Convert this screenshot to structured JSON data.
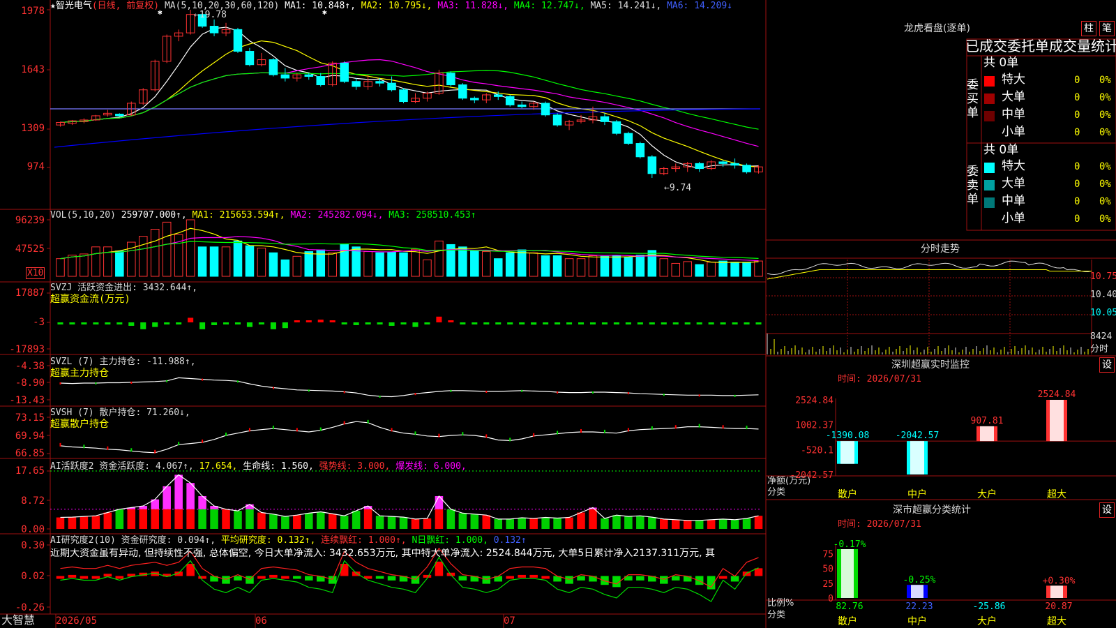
{
  "colors": {
    "up": "#ff3232",
    "down": "#00ffff",
    "ma1": "#ffffff",
    "ma2": "#ffff00",
    "ma3": "#ff00ff",
    "ma4": "#00ff00",
    "ma5": "#7878ff",
    "ma6": "#0000ff",
    "grid": "#a01010",
    "pos": "#ff0000",
    "neg": "#00dd00",
    "bg": "#000000"
  },
  "header": {
    "title": "★智光电气",
    "period": "(日线, 前复权)",
    "ma_params": "MA(5,10,20,30,60,120)",
    "ma1": "MA1: 10.848↑,",
    "ma2": "MA2: 10.795↓,",
    "ma3": "MA3: 11.828↓,",
    "ma4": "MA4: 12.747↓,",
    "ma5": "MA5: 14.241↓,",
    "ma6": "MA6: 14.209↓"
  },
  "price_panel": {
    "y_labels": [
      "1978",
      "1643",
      "1309",
      "974"
    ],
    "high_marker": "←19.78",
    "low_marker": "←9.74",
    "star": "✱"
  },
  "vol_panel": {
    "header_name": "VOL(5,10,20)",
    "header_val": "259707.000↑,",
    "ma1": "MA1: 215653.594↑,",
    "ma2": "MA2: 245282.094↓,",
    "ma3": "MA3: 258510.453↑",
    "y_labels": [
      "96239",
      "47525"
    ],
    "unit": "X10"
  },
  "svzj_panel": {
    "header": "SVZJ  活跃资金进出: 3432.644↑,",
    "sub": "超赢资金流(万元)",
    "y_labels": [
      "17887",
      "-3",
      "-17893"
    ]
  },
  "svzl_panel": {
    "header": "SVZL (7) 主力持仓: -11.988↑,",
    "sub": "超赢主力持仓",
    "y_labels": [
      "-4.38",
      "-8.90",
      "-13.43"
    ]
  },
  "svsh_panel": {
    "header": "SVSH (7) 散户持仓: 71.260↓,",
    "sub": "超赢散户持仓",
    "y_labels": [
      "73.15",
      "69.94",
      "66.85"
    ]
  },
  "ai_panel": {
    "h1": "AI活跃度2 资金活跃度: 4.067↑,",
    "h2": "17.654,",
    "h3": "生命线: 1.560,",
    "h4": "强势线: 3.000,",
    "h5": "爆发线: 6.000,",
    "y_labels": [
      "17.65",
      "8.72",
      "0.00"
    ]
  },
  "ai2_panel": {
    "h1": "AI研究度2(10) 资金研究度: 0.094↑,",
    "h2": "平均研究度: 0.132↑,",
    "h3": "连续飘红: 1.000↑,",
    "h4": "N日飘红: 1.000,",
    "h5": "0.132↑",
    "text": "近期大资金虽有异动, 但持续性不强, 总体偏空, 今日大单净流入: 3432.653万元, 其中特大单净流入: 2524.844万元, 大单5日累计净入2137.311万元, 其",
    "y_labels": [
      "0.30",
      "0.02",
      "-0.26"
    ]
  },
  "x_axis": {
    "brand": "大智慧",
    "labels": [
      "2026/05",
      "06",
      "07"
    ]
  },
  "right": {
    "lhb_title": "龙虎看盘(逐单)",
    "btn_zhu": "柱",
    "btn_bi": "笔",
    "order_title": "已成交委托单成交量统计",
    "buy_label": "委买单",
    "sell_label": "委卖单",
    "buy_total": "共 0单",
    "sell_total": "共 0单",
    "rows": [
      {
        "name": "特大",
        "n": "0",
        "p": "0%",
        "c": "#ff0000"
      },
      {
        "name": "大单",
        "n": "0",
        "p": "0%",
        "c": "#a00000"
      },
      {
        "name": "中单",
        "n": "0",
        "p": "0%",
        "c": "#6e0000"
      },
      {
        "name": "小单",
        "n": "0",
        "p": "0%",
        "c": "#000000"
      }
    ],
    "sell_rows": [
      {
        "name": "特大",
        "n": "0",
        "p": "0%",
        "c": "#00ffff"
      },
      {
        "name": "大单",
        "n": "0",
        "p": "0%",
        "c": "#00a0a0"
      },
      {
        "name": "中单",
        "n": "0",
        "p": "0%",
        "c": "#007878"
      },
      {
        "name": "小单",
        "n": "0",
        "p": "0%",
        "c": "#000000"
      }
    ],
    "fs_title": "分时走势",
    "fs_labels": [
      "10.75",
      "10.40",
      "10.05"
    ],
    "fs_vol": "8424",
    "fs_unit": "分时",
    "sz_title": "深圳超赢实时监控",
    "sz_btn": "设",
    "sz_time": "时间: 2026/07/31",
    "sz_y": [
      "2524.84",
      "1002.37",
      "-520.1",
      "-2042.57"
    ],
    "sz_bars": [
      {
        "cat": "散户",
        "val": -1390.08,
        "txt": "-1390.08"
      },
      {
        "cat": "中户",
        "val": -2042.57,
        "txt": "-2042.57"
      },
      {
        "cat": "大户",
        "val": 907.81,
        "txt": "907.81"
      },
      {
        "cat": "超大",
        "val": 2524.84,
        "txt": "2524.84"
      }
    ],
    "sz_axis1": "净额(万元)",
    "sz_axis2": "分类",
    "ss_title": "深市超赢分类统计",
    "ss_btn": "设",
    "ss_time": "时间: 2026/07/31",
    "ss_y": [
      "75",
      "50",
      "25",
      "0"
    ],
    "ss_bars": [
      {
        "cat": "散户",
        "val": 82.76,
        "txt": "82.76",
        "chg": "-0.17%"
      },
      {
        "cat": "中户",
        "val": 22.23,
        "txt": "22.23",
        "chg": "-0.25%"
      },
      {
        "cat": "大户",
        "val": -25.86,
        "txt": "-25.86",
        "chg": ""
      },
      {
        "cat": "超大",
        "val": 20.87,
        "txt": "20.87",
        "chg": "+0.30%"
      }
    ],
    "ss_axis1": "比例%",
    "ss_axis2": "分类"
  },
  "chart_data": {
    "type": "candlestick",
    "title": "智光电气",
    "ylim": [
      9.74,
      19.78
    ],
    "candles": [
      [
        12.9,
        13.05,
        12.8,
        13.1
      ],
      [
        13.0,
        13.15,
        12.9,
        13.2
      ],
      [
        13.1,
        13.2,
        13.0,
        13.3
      ],
      [
        13.2,
        13.45,
        13.15,
        13.5
      ],
      [
        13.5,
        13.6,
        13.4,
        13.8
      ],
      [
        13.55,
        13.45,
        13.4,
        13.6
      ],
      [
        13.5,
        14.2,
        13.45,
        14.3
      ],
      [
        14.2,
        15.0,
        14.1,
        15.1
      ],
      [
        15.0,
        16.7,
        14.9,
        16.8
      ],
      [
        16.7,
        18.2,
        16.6,
        18.3
      ],
      [
        18.2,
        18.4,
        17.9,
        18.6
      ],
      [
        18.4,
        19.5,
        18.3,
        19.78
      ],
      [
        19.5,
        18.8,
        18.7,
        19.6
      ],
      [
        18.8,
        18.4,
        18.2,
        19.2
      ],
      [
        18.4,
        18.6,
        18.2,
        19.0
      ],
      [
        18.6,
        17.3,
        17.2,
        18.7
      ],
      [
        17.3,
        16.5,
        16.4,
        17.5
      ],
      [
        16.5,
        16.8,
        16.4,
        17.2
      ],
      [
        16.8,
        15.9,
        15.8,
        16.9
      ],
      [
        15.9,
        15.7,
        15.5,
        16.3
      ],
      [
        15.7,
        15.9,
        15.5,
        16.0
      ],
      [
        15.9,
        15.8,
        15.6,
        16.0
      ],
      [
        15.8,
        15.3,
        15.2,
        16.0
      ],
      [
        15.3,
        16.6,
        15.2,
        16.7
      ],
      [
        16.6,
        15.5,
        15.4,
        16.7
      ],
      [
        15.5,
        15.2,
        15.0,
        15.7
      ],
      [
        15.2,
        15.5,
        15.0,
        15.9
      ],
      [
        15.5,
        15.4,
        15.2,
        15.7
      ],
      [
        15.4,
        15.0,
        14.9,
        15.8
      ],
      [
        15.0,
        14.3,
        14.2,
        15.1
      ],
      [
        14.3,
        14.5,
        14.2,
        14.8
      ],
      [
        14.5,
        14.8,
        14.3,
        14.9
      ],
      [
        14.8,
        16.0,
        14.7,
        16.2
      ],
      [
        16.0,
        15.3,
        15.2,
        16.1
      ],
      [
        15.3,
        14.5,
        14.4,
        15.4
      ],
      [
        14.5,
        14.4,
        14.2,
        14.6
      ],
      [
        14.4,
        14.7,
        14.2,
        14.8
      ],
      [
        14.7,
        14.6,
        14.4,
        14.9
      ],
      [
        14.6,
        14.1,
        14.0,
        14.7
      ],
      [
        14.1,
        14.0,
        13.9,
        14.3
      ],
      [
        14.0,
        14.2,
        13.8,
        14.3
      ],
      [
        14.2,
        13.5,
        13.4,
        14.3
      ],
      [
        13.5,
        12.9,
        12.8,
        13.6
      ],
      [
        12.9,
        13.1,
        12.6,
        13.2
      ],
      [
        13.1,
        13.2,
        13.0,
        13.5
      ],
      [
        13.2,
        13.4,
        13.0,
        14.0
      ],
      [
        13.4,
        13.1,
        12.9,
        13.6
      ],
      [
        13.1,
        12.4,
        12.3,
        13.2
      ],
      [
        12.4,
        11.8,
        11.7,
        12.5
      ],
      [
        11.8,
        11.0,
        10.9,
        11.9
      ],
      [
        11.0,
        10.0,
        9.74,
        11.1
      ],
      [
        10.0,
        10.3,
        9.9,
        10.4
      ],
      [
        10.3,
        10.4,
        10.1,
        10.6
      ],
      [
        10.4,
        10.6,
        10.1,
        10.7
      ],
      [
        10.6,
        10.3,
        10.1,
        10.7
      ],
      [
        10.3,
        10.7,
        10.2,
        10.8
      ],
      [
        10.7,
        10.6,
        10.4,
        10.8
      ],
      [
        10.6,
        10.5,
        10.3,
        10.9
      ],
      [
        10.5,
        10.1,
        10.0,
        10.6
      ],
      [
        10.1,
        10.4,
        10.0,
        10.5
      ]
    ],
    "volume": [
      30,
      36,
      38,
      50,
      50,
      43,
      58,
      68,
      80,
      92,
      71,
      96,
      50,
      50,
      50,
      60,
      52,
      48,
      40,
      28,
      34,
      42,
      45,
      40,
      54,
      50,
      42,
      40,
      41,
      40,
      46,
      28,
      60,
      54,
      50,
      44,
      42,
      30,
      40,
      45,
      40,
      35,
      35,
      30,
      30,
      35,
      34,
      35,
      32,
      36,
      44,
      30,
      22,
      25,
      20,
      24,
      26,
      24,
      24,
      26
    ],
    "svzj": [
      -400,
      -500,
      -600,
      -700,
      -600,
      -800,
      -1500,
      -3000,
      -2000,
      -600,
      -500,
      2000,
      -3000,
      -1200,
      -900,
      -900,
      -2000,
      -700,
      -3000,
      -2500,
      500,
      700,
      1200,
      600,
      -500,
      -1200,
      -700,
      -600,
      -1500,
      -800,
      -2000,
      -500,
      2500,
      800,
      -600,
      -500,
      -800,
      -700,
      -600,
      -500,
      -1000,
      -900,
      -800,
      -700,
      -600,
      -600,
      -500,
      -500,
      -600,
      -500,
      -400,
      -600,
      -500,
      -600,
      -500,
      -500,
      -400,
      -500,
      -400,
      -500
    ],
    "svzl": [
      -9.0,
      -9.1,
      -9.0,
      -9.0,
      -8.9,
      -8.9,
      -8.8,
      -8.7,
      -8.6,
      -8.4,
      -7.6,
      -7.8,
      -8.0,
      -8.2,
      -8.3,
      -8.5,
      -9.2,
      -9.8,
      -10.2,
      -10.5,
      -10.8,
      -10.9,
      -11.0,
      -11.1,
      -11.3,
      -11.6,
      -12.2,
      -12.5,
      -12.6,
      -12.3,
      -11.8,
      -11.5,
      -11.2,
      -11.0,
      -11.0,
      -11.1,
      -11.2,
      -11.2,
      -11.1,
      -11.0,
      -11.1,
      -11.2,
      -11.4,
      -11.5,
      -11.5,
      -11.4,
      -11.4,
      -11.5,
      -11.6,
      -11.8,
      -11.9,
      -12.0,
      -12.1,
      -12.2,
      -12.2,
      -12.2,
      -12.3,
      -12.3,
      -12.2,
      -12.1
    ],
    "svsh": [
      68.2,
      68.0,
      67.9,
      67.8,
      67.6,
      67.5,
      67.3,
      67.1,
      67.0,
      67.6,
      68.4,
      68.6,
      68.8,
      69.3,
      70.0,
      70.4,
      70.8,
      71.0,
      71.2,
      71.0,
      70.8,
      70.6,
      70.9,
      71.4,
      72.0,
      72.4,
      72.2,
      71.4,
      70.8,
      70.4,
      70.2,
      69.9,
      69.8,
      70.0,
      70.1,
      70.0,
      69.7,
      69.2,
      69.1,
      69.4,
      69.9,
      70.1,
      70.3,
      70.5,
      70.6,
      70.6,
      70.5,
      70.4,
      70.8,
      71.0,
      71.1,
      71.2,
      71.3,
      71.5,
      71.5,
      71.4,
      71.3,
      71.2,
      71.2,
      71.1
    ],
    "ai": [
      3.5,
      3.6,
      3.8,
      4.0,
      5.0,
      6.0,
      6.5,
      7.0,
      9.0,
      13.0,
      16.5,
      14.0,
      10.0,
      7.0,
      6.0,
      5.5,
      7.5,
      5.0,
      4.5,
      3.8,
      4.2,
      4.8,
      5.2,
      4.6,
      4.0,
      5.5,
      7.0,
      4.0,
      3.8,
      3.6,
      3.0,
      3.2,
      10.0,
      6.0,
      4.8,
      4.5,
      4.2,
      3.0,
      3.0,
      3.4,
      3.2,
      3.5,
      3.3,
      3.5,
      5.0,
      6.5,
      3.2,
      4.2,
      3.8,
      4.0,
      3.6,
      3.0,
      2.8,
      2.6,
      2.6,
      2.8,
      3.0,
      2.8,
      3.2,
      4.0
    ],
    "ai2": [
      0.02,
      0.03,
      0.02,
      0.02,
      0.04,
      0.02,
      0.04,
      0.05,
      0.06,
      0.04,
      0.06,
      0.13,
      0.02,
      -0.03,
      -0.05,
      -0.02,
      -0.05,
      0.02,
      0.03,
      0.02,
      0.01,
      -0.02,
      -0.03,
      -0.05,
      0.13,
      0.06,
      0.02,
      0.0,
      -0.02,
      -0.03,
      -0.05,
      0.03,
      0.15,
      0.05,
      -0.02,
      -0.03,
      -0.05,
      -0.03,
      0.02,
      0.03,
      0.03,
      0.02,
      -0.03,
      -0.05,
      -0.02,
      -0.03,
      -0.06,
      -0.08,
      -0.02,
      -0.02,
      -0.03,
      -0.05,
      -0.02,
      -0.03,
      -0.06,
      -0.1,
      0.02,
      -0.03,
      0.06,
      0.09
    ]
  }
}
